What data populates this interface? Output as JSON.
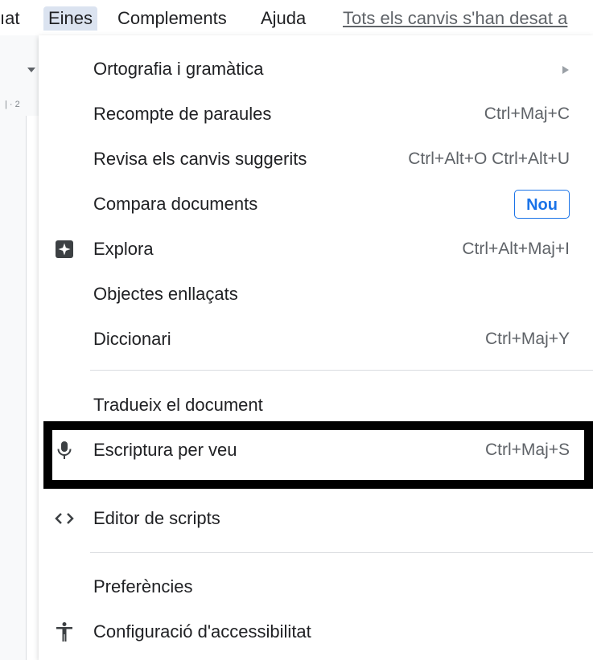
{
  "menubar": {
    "items": [
      {
        "label": "ıat"
      },
      {
        "label": "Eines"
      },
      {
        "label": "Complements"
      },
      {
        "label": "Ajuda"
      }
    ],
    "save_status": "Tots els canvis s'han desat a"
  },
  "background": {
    "ruler_text": "2"
  },
  "menu": {
    "items": [
      {
        "label": "Ortografia i gramàtica"
      },
      {
        "label": "Recompte de paraules",
        "shortcut": "Ctrl+Maj+C"
      },
      {
        "label": "Revisa els canvis suggerits",
        "shortcut": "Ctrl+Alt+O Ctrl+Alt+U"
      },
      {
        "label": "Compara documents",
        "badge": "Nou"
      },
      {
        "label": "Explora",
        "shortcut": "Ctrl+Alt+Maj+I",
        "icon": "explore-icon"
      },
      {
        "label": "Objectes enllaçats"
      },
      {
        "label": "Diccionari",
        "shortcut": "Ctrl+Maj+Y"
      },
      {
        "label": "Tradueix el document"
      },
      {
        "label": "Escriptura per veu",
        "shortcut": "Ctrl+Maj+S",
        "icon": "microphone-icon"
      },
      {
        "label": "Editor de scripts",
        "icon": "code-icon"
      },
      {
        "label": "Preferències"
      },
      {
        "label": "Configuració d'accessibilitat",
        "icon": "accessibility-icon"
      }
    ]
  },
  "colors": {
    "accent": "#1a73e8",
    "active_menu_bg": "#dbe3f0",
    "highlight_border": "#000000"
  }
}
